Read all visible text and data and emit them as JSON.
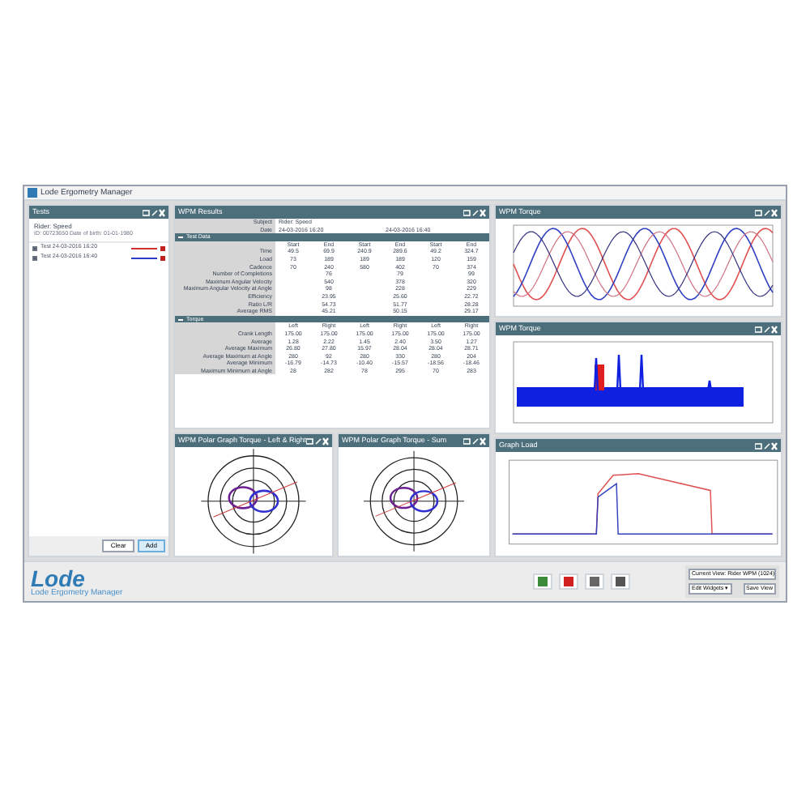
{
  "window": {
    "title": "Lode Ergometry Manager"
  },
  "tests": {
    "title": "Tests",
    "subject": "Rider: Speed",
    "subject_meta": "ID: 00723650   Date of birth: 01-01-1980",
    "items": [
      {
        "label": "Test 24-03-2016 16:20",
        "checked": true,
        "color": "#d03030"
      },
      {
        "label": "Test 24-03-2016 16:40",
        "checked": true,
        "color": "#2a3cc8"
      }
    ],
    "buttons": [
      "Clear",
      "Add"
    ]
  },
  "results": {
    "title": "WPM Results",
    "subject_label": "Subject",
    "subject": "Rider: Speed",
    "date_label": "Date",
    "dates": [
      "24-03-2016 16:20",
      "24-03-2016 16:40"
    ],
    "sections": [
      {
        "title": "Test Data",
        "expanded": true,
        "headers": [
          "Start",
          "End",
          "Start",
          "End",
          "Start",
          "End"
        ],
        "rows": [
          {
            "label": "Time",
            "cells": [
              "49.5",
              "69.9",
              "240.9",
              "289.6",
              "49.2",
              "324.7"
            ]
          },
          {
            "label": "Load",
            "cells": [
              "73",
              "189",
              "189",
              "189",
              "120",
              "159"
            ]
          },
          {
            "label": "Cadence",
            "cells": [
              "70",
              "240",
              "580",
              "402",
              "70",
              "374"
            ]
          },
          {
            "label": "Number of Completions",
            "cells": [
              "",
              "76",
              "",
              "79",
              "",
              "99"
            ]
          },
          {
            "label": "Maximum Angular Velocity",
            "cells": [
              "",
              "540",
              "",
              "378",
              "",
              "320"
            ]
          },
          {
            "label": "Maximum Angular Velocity at Angle",
            "cells": [
              "",
              "98",
              "",
              "228",
              "",
              "229"
            ]
          },
          {
            "label": "Efficiency",
            "cells": [
              "",
              "23.95",
              "",
              "25.60",
              "",
              "22.72"
            ]
          },
          {
            "label": "Ratio L/R",
            "cells": [
              "",
              "54.73",
              "",
              "51.77",
              "",
              "28.28"
            ]
          },
          {
            "label": "Average RMS",
            "cells": [
              "",
              "45.21",
              "",
              "50.15",
              "",
              "29.17"
            ]
          }
        ]
      },
      {
        "title": "Torque",
        "expanded": true,
        "headers": [
          "Left",
          "Right",
          "Left",
          "Right",
          "Left",
          "Right"
        ],
        "rows": [
          {
            "label": "Crank Length",
            "cells": [
              "175.00",
              "175.00",
              "175.00",
              "175.00",
              "175.00",
              "175.00"
            ]
          },
          {
            "label": "Average",
            "cells": [
              "1.28",
              "2.22",
              "1.45",
              "2.40",
              "3.50",
              "1.27"
            ]
          },
          {
            "label": "Average Maximum",
            "cells": [
              "26.80",
              "27.80",
              "15.97",
              "28.04",
              "28.04",
              "28.71"
            ]
          },
          {
            "label": "Average Maximum at Angle",
            "cells": [
              "280",
              "92",
              "280",
              "330",
              "280",
              "204"
            ]
          },
          {
            "label": "Average Minimum",
            "cells": [
              "-16.79",
              "-14.73",
              "-10.40",
              "-15.57",
              "-18.56",
              "-18.46"
            ]
          },
          {
            "label": "Maximum Minimum at Angle",
            "cells": [
              "28",
              "282",
              "78",
              "295",
              "70",
              "283"
            ]
          }
        ]
      }
    ]
  },
  "charts": [
    {
      "title": "WPM Torque",
      "kind": "waves"
    },
    {
      "title": "WPM Torque",
      "kind": "noise"
    },
    {
      "title": "WPM Polar Graph Torque - Left & Right",
      "kind": "polar"
    },
    {
      "title": "WPM Polar Graph Torque - Sum",
      "kind": "polar"
    },
    {
      "title": "Graph Load",
      "kind": "load"
    }
  ],
  "footer": {
    "logo": "Lode",
    "tagline": "Lode Ergometry Manager",
    "view": "Current View: Rider WPM (1024)",
    "widgets_button": "Edit Widgets ▾",
    "save_button": "Save View"
  }
}
